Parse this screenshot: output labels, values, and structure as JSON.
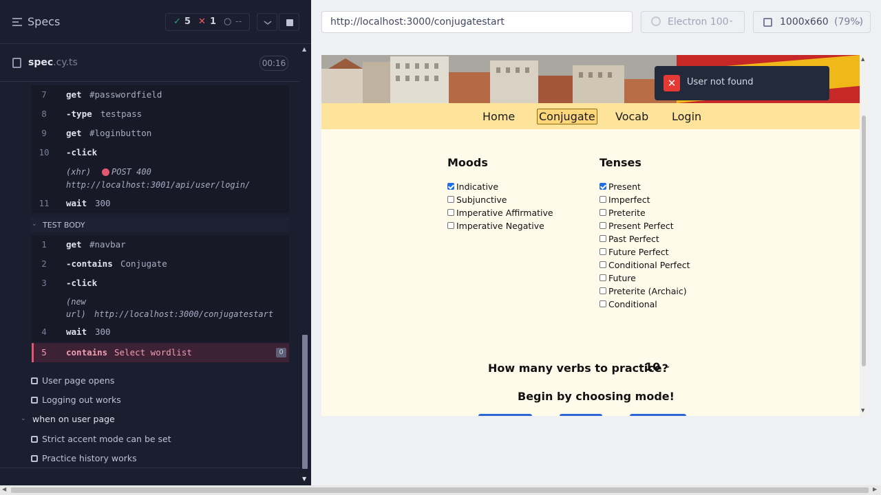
{
  "header": {
    "title": "Specs",
    "stats": {
      "passed": "5",
      "failed": "1",
      "pending": "--"
    }
  },
  "spec": {
    "name": "spec",
    "ext": ".cy.ts",
    "duration": "00:16"
  },
  "commands_before": [
    {
      "num": "7",
      "name": "get",
      "arg": "#passwordfield"
    },
    {
      "num": "8",
      "name": "-type",
      "arg": "testpass"
    },
    {
      "num": "9",
      "name": "get",
      "arg": "#loginbutton"
    },
    {
      "num": "10",
      "name": "-click",
      "arg": ""
    }
  ],
  "xhr": {
    "label": "(xhr)",
    "method_status": "POST 400",
    "url": "http://localhost:3001/api/user/login/"
  },
  "command_wait_before": {
    "num": "11",
    "name": "wait",
    "arg": "300"
  },
  "test_body_label": "TEST BODY",
  "commands_body": [
    {
      "num": "1",
      "name": "get",
      "arg": "#navbar"
    },
    {
      "num": "2",
      "name": "-contains",
      "arg": "Conjugate"
    },
    {
      "num": "3",
      "name": "-click",
      "arg": ""
    }
  ],
  "new_url": {
    "label_line1": "(new",
    "label_line2": "url)",
    "url": "http://localhost:3000/conjugatestart"
  },
  "command_wait_body": {
    "num": "4",
    "name": "wait",
    "arg": "300"
  },
  "failed_command": {
    "num": "5",
    "name": "contains",
    "arg": "Select wordlist",
    "badge": "0"
  },
  "tests": [
    {
      "label": "User page opens"
    },
    {
      "label": "Logging out works"
    }
  ],
  "suite": {
    "label": "when on user page"
  },
  "suite_tests": [
    {
      "label": "Strict accent mode can be set"
    },
    {
      "label": "Practice history works"
    }
  ],
  "browser": {
    "url": "http://localhost:3000/conjugatestart",
    "name": "Electron 100",
    "viewport": "1000x660",
    "scale": "(79%)"
  },
  "app": {
    "nav": [
      "Home",
      "Conjugate",
      "Vocab",
      "Login"
    ],
    "moods_title": "Moods",
    "moods": [
      {
        "label": "Indicative",
        "checked": true
      },
      {
        "label": "Subjunctive",
        "checked": false
      },
      {
        "label": "Imperative Affirmative",
        "checked": false
      },
      {
        "label": "Imperative Negative",
        "checked": false
      }
    ],
    "tenses_title": "Tenses",
    "tenses": [
      {
        "label": "Present",
        "checked": true
      },
      {
        "label": "Imperfect",
        "checked": false
      },
      {
        "label": "Preterite",
        "checked": false
      },
      {
        "label": "Present Perfect",
        "checked": false
      },
      {
        "label": "Past Perfect",
        "checked": false
      },
      {
        "label": "Future Perfect",
        "checked": false
      },
      {
        "label": "Conditional Perfect",
        "checked": false
      },
      {
        "label": "Future",
        "checked": false
      },
      {
        "label": "Preterite (Archaic)",
        "checked": false
      },
      {
        "label": "Conditional",
        "checked": false
      }
    ],
    "verbs_question": "How many verbs to practice?",
    "verbs_count": "10",
    "begin_text": "Begin by choosing mode!",
    "toast": "User not found"
  },
  "colors": {
    "pass": "#1fa971",
    "fail": "#e45770",
    "accent": "#2c66d4",
    "navbar": "#fde49a",
    "page_bg": "#fffaea"
  }
}
